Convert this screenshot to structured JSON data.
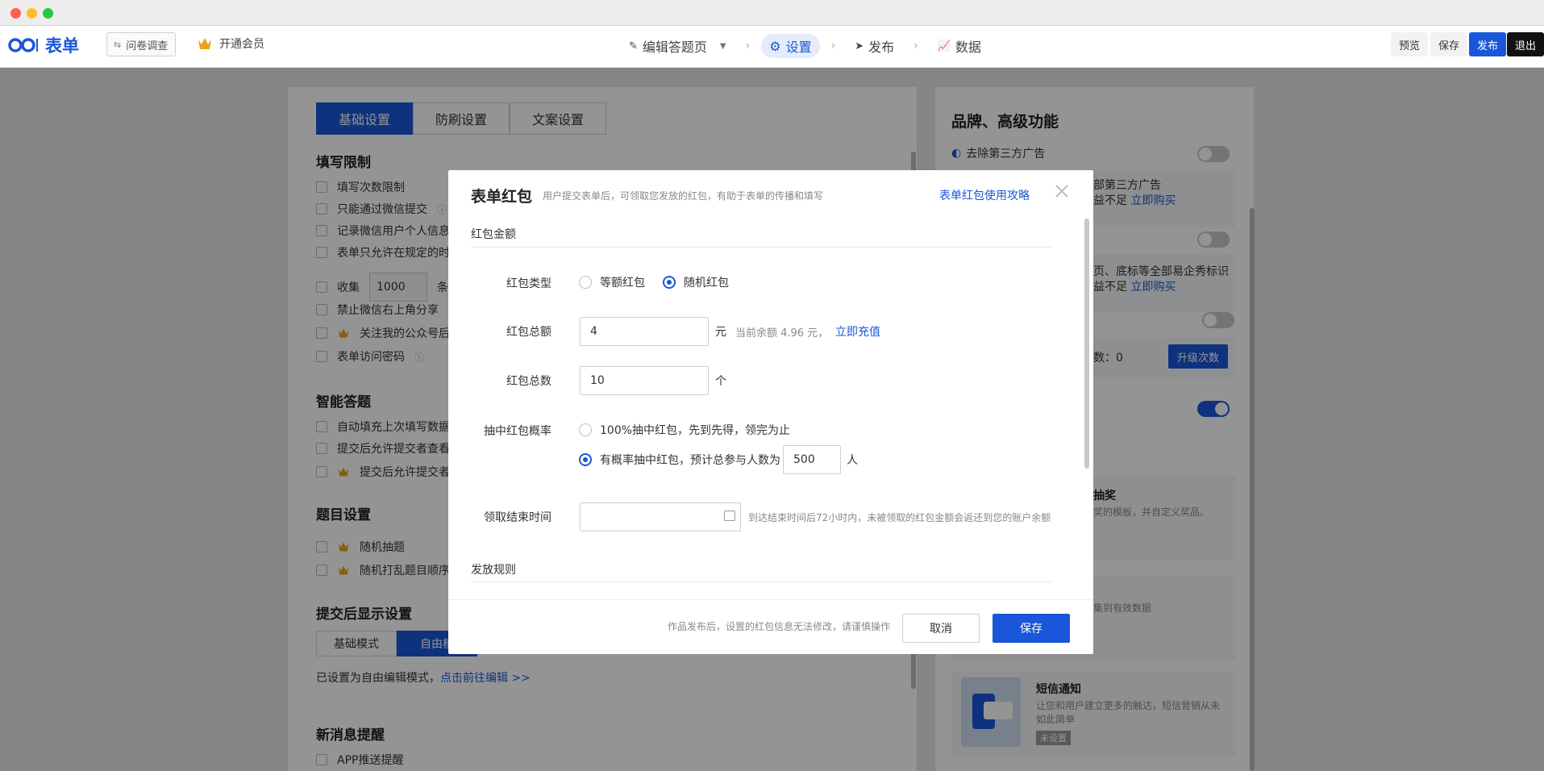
{
  "topbar": {
    "logo_text": "表单",
    "survey_label": "问卷调查",
    "member_label": "开通会员",
    "steps": [
      {
        "label": "编辑答题页"
      },
      {
        "label": "设置"
      },
      {
        "label": "发布"
      },
      {
        "label": "数据"
      }
    ],
    "preview_label": "预览",
    "save_label": "保存",
    "publish_label": "发布",
    "exit_label": "退出"
  },
  "settings": {
    "tabs": [
      "基础设置",
      "防刷设置",
      "文案设置"
    ],
    "fill_limit_title": "填写限制",
    "fill_limits": [
      "填写次数限制",
      "只能通过微信提交",
      "记录微信用户个人信息",
      "表单只允许在规定的时",
      "收集",
      "禁止微信右上角分享",
      "关注我的公众号后",
      "表单访问密码"
    ],
    "collect_value": "1000",
    "collect_suffix": "条",
    "smart_title": "智能答题",
    "smart_items": [
      "自动填充上次填写数据",
      "提交后允许提交者查看",
      "提交后允许提交者"
    ],
    "question_title": "题目设置",
    "question_items": [
      "随机抽题",
      "随机打乱题目顺序"
    ],
    "after_submit_title": "提交后显示设置",
    "mode_tabs": [
      "基础模式",
      "自由模"
    ],
    "mode_note": "已设置为自由编辑模式，",
    "mode_link": "点击前往编辑 >>",
    "notify_title": "新消息提醒",
    "notify_items": [
      "APP推送提醒"
    ]
  },
  "right": {
    "title": "品牌、高级功能",
    "ad_label": "去除第三方广告",
    "ad_desc": "部第三方广告",
    "insufficient": "益不足",
    "buy": "立即购买",
    "logo_desc": "页、底标等全部易企秀标识",
    "count_label": "数：0",
    "upgrade": "升级次数",
    "lottery_title": "抽奖",
    "lottery_desc": "奖的模板，并自定义奖品。",
    "data_desc": "集到有效数据",
    "sms_title": "短信通知",
    "sms_desc1": "让您和用户建立更多的触达，短信营销从未",
    "sms_desc2": "如此简单",
    "sms_badge": "未设置"
  },
  "modal": {
    "title": "表单红包",
    "subtitle": "用户提交表单后，可领取您发放的红包，有助于表单的传播和填写",
    "guide_link": "表单红包使用攻略",
    "section_amount": "红包金额",
    "type_label": "红包类型",
    "type_options": [
      "等额红包",
      "随机红包"
    ],
    "total_label": "红包总额",
    "total_value": "4",
    "total_unit": "元",
    "balance_text": "当前余额 4.96 元，",
    "recharge": "立即充值",
    "count_label": "红包总数",
    "count_value": "10",
    "count_unit": "个",
    "prob_label": "抽中红包概率",
    "prob_option1": "100%抽中红包，先到先得，领完为止",
    "prob_option2": "有概率抽中红包，预计总参与人数为",
    "participants": "500",
    "participants_unit": "人",
    "end_label": "领取结束时间",
    "end_placeholder": "",
    "end_hint": "到达结束时间后72小时内，未被领取的红包金额会返还到您的账户余额",
    "section_rules": "发放规则",
    "footer_note": "作品发布后，设置的红包信息无法修改，请谨慎操作",
    "cancel": "取消",
    "save": "保存"
  },
  "colors": {
    "accent": "#1a56d9",
    "mac_red": "#fe5f57",
    "mac_yellow": "#febc2e",
    "mac_green": "#28c840"
  }
}
